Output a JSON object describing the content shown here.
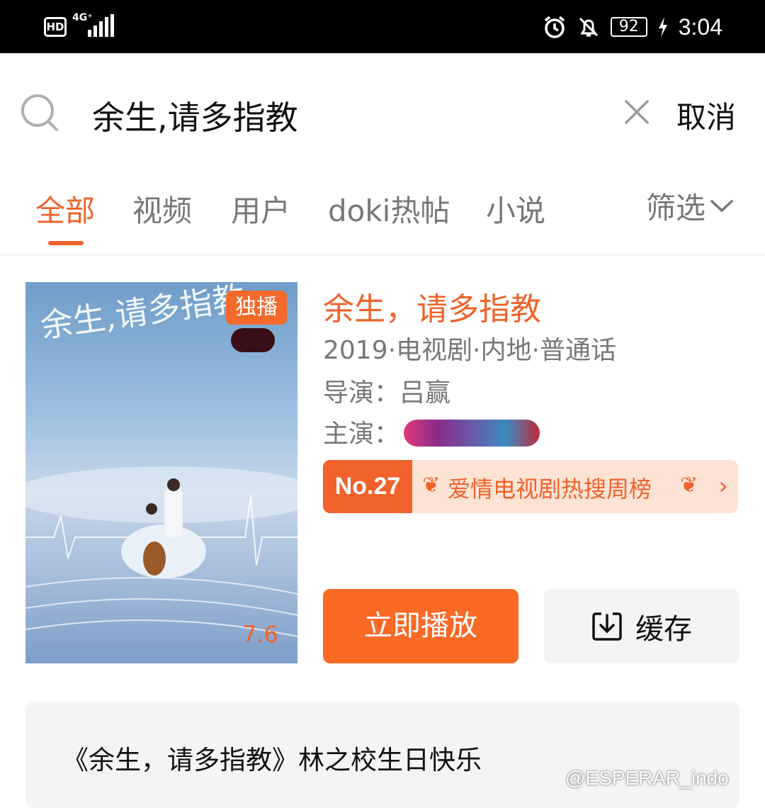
{
  "status_bar": {
    "hd": "HD",
    "network": "4G⁺",
    "battery": "92",
    "time": "3:04",
    "icons": [
      "alarm-icon",
      "mute-bell-icon",
      "charging-icon"
    ]
  },
  "search": {
    "query": "余生,请多指教",
    "cancel_label": "取消"
  },
  "tabs": [
    {
      "label": "全部",
      "active": true
    },
    {
      "label": "视频"
    },
    {
      "label": "用户"
    },
    {
      "label": "doki热帖"
    },
    {
      "label": "小说"
    }
  ],
  "filter_label": "筛选",
  "result": {
    "poster_title": "余生,请多指教",
    "exclusive_badge": "独播",
    "score": "7.6",
    "title": "余生，请多指教",
    "meta": "2019·电视剧·内地·普通话",
    "director": "导演：吕赢",
    "cast_label": "主演：",
    "rank_no": "No.27",
    "rank_label": "爱情电视剧热搜周榜",
    "play_label": "立即播放",
    "cache_label": "缓存"
  },
  "description": "《余生，请多指教》林之校生日快乐",
  "watermark": "@ESPERAR_indo",
  "colors": {
    "accent": "#f0622a",
    "play": "#fa6a25"
  }
}
